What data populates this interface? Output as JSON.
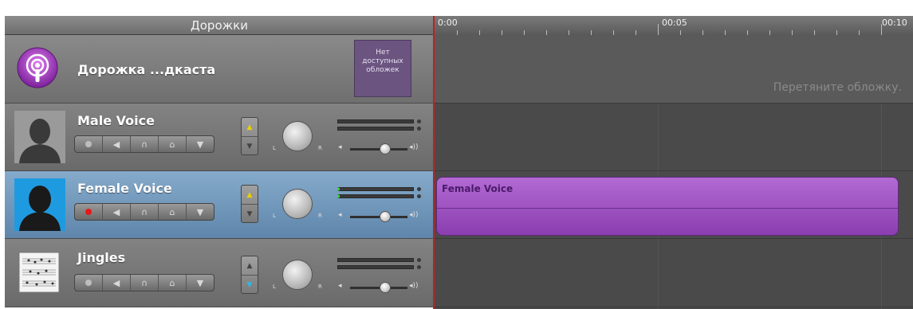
{
  "header": {
    "title": "Дорожки"
  },
  "tracks": [
    {
      "name": "Дорожка ...дкаста",
      "artwork_placeholder": "Нет доступных обложек"
    },
    {
      "name": "Male Voice"
    },
    {
      "name": "Female Voice",
      "selected": true,
      "recording": true
    },
    {
      "name": "Jingles"
    }
  ],
  "timeline": {
    "ruler": [
      "0:00",
      "00:05",
      "00:10"
    ],
    "artwork_hint": "Перетяните обложку.",
    "region_label": "Female Voice"
  },
  "knob": {
    "left": "L",
    "right": "R"
  },
  "colors": {
    "region": "#a056c8",
    "selected_track": "#6f96bd",
    "playhead": "#c81d1d"
  }
}
